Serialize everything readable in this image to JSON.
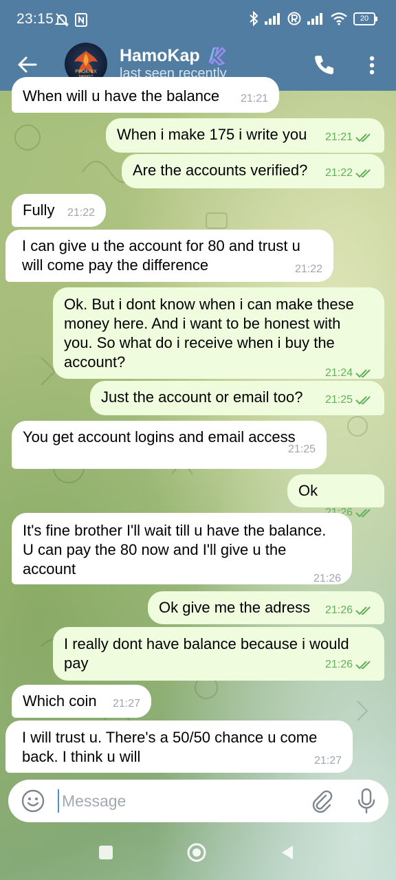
{
  "status_bar": {
    "time": "23:15",
    "battery": "20"
  },
  "header": {
    "contact_name": "HamoKap",
    "contact_status": "last seen recently"
  },
  "messages": [
    {
      "direction": "in",
      "text": "When will u have the balance",
      "time": "21:21",
      "read": false
    },
    {
      "direction": "out",
      "text": "When i make 175 i write you",
      "time": "21:21",
      "read": true
    },
    {
      "direction": "out",
      "text": "Are the accounts verified?",
      "time": "21:22",
      "read": true
    },
    {
      "direction": "in",
      "text": "Fully",
      "time": "21:22",
      "read": false
    },
    {
      "direction": "in",
      "text": "I can give u the account for 80 and trust u will come pay the difference",
      "time": "21:22",
      "read": false
    },
    {
      "direction": "out",
      "text": "Ok. But i dont know when i can make these money here. And i want to be honest with you. So what do i receive when i buy the account?",
      "time": "21:24",
      "read": true
    },
    {
      "direction": "out",
      "text": "Just the account or email too?",
      "time": "21:25",
      "read": true
    },
    {
      "direction": "in",
      "text": "You get account logins and email access",
      "time": "21:25",
      "read": false
    },
    {
      "direction": "out",
      "text": "Ok",
      "time": "21:26",
      "read": true
    },
    {
      "direction": "in",
      "text": "It's fine brother I'll wait till u have the balance. U can pay the 80 now and I'll give u the account",
      "time": "21:26",
      "read": false
    },
    {
      "direction": "out",
      "text": "Ok give me the adress",
      "time": "21:26",
      "read": true
    },
    {
      "direction": "out",
      "text": "I  really dont have balance because i would pay",
      "time": "21:26",
      "read": true
    },
    {
      "direction": "in",
      "text": "Which coin",
      "time": "21:27",
      "read": false
    },
    {
      "direction": "in",
      "text": "I will trust u. There's a 50/50 chance u come back. I think u will",
      "time": "21:27",
      "read": false
    }
  ],
  "composer": {
    "placeholder": "Message"
  },
  "icons": {
    "back": "arrow-left-icon",
    "call": "phone-icon",
    "menu": "more-vert-icon",
    "emoji": "smile-icon",
    "attach": "paperclip-icon",
    "mic": "microphone-icon",
    "read_receipt": "double-check-icon"
  },
  "colors": {
    "header": "#527da3",
    "outgoing_bubble": "#effdde",
    "incoming_bubble": "#ffffff",
    "read_check": "#5fb059"
  }
}
